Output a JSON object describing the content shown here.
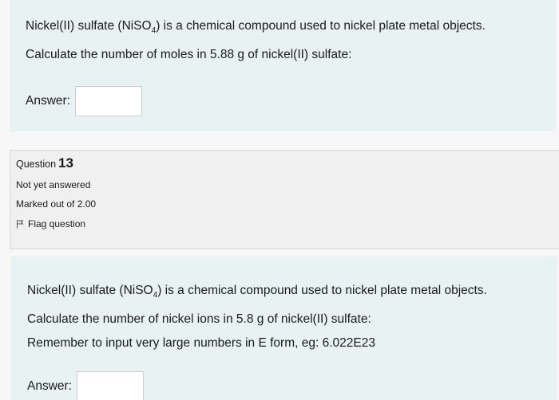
{
  "question_prev": {
    "text_before_formula": "Nickel(II) sulfate (NiSO",
    "formula_subscript": "4",
    "text_after_formula": ") is a chemical compound used to nickel plate metal objects.",
    "line2": "Calculate the number of moles in 5.88 g of nickel(II) sulfate:",
    "answer_label": "Answer:",
    "answer_value": ""
  },
  "question_info": {
    "question_label": "Question",
    "question_number": "13",
    "status": "Not yet answered",
    "marks": "Marked out of 2.00",
    "flag_label": "Flag question"
  },
  "question_current": {
    "text_before_formula": "Nickel(II) sulfate (NiSO",
    "formula_subscript": "4",
    "text_after_formula": ") is a chemical compound used to nickel plate metal objects.",
    "line2": "Calculate the number of nickel ions in 5.8 g of nickel(II) sulfate:",
    "line3": "Remember to input very large numbers in E form, eg: 6.022E23",
    "answer_label": "Answer:",
    "answer_value": ""
  }
}
